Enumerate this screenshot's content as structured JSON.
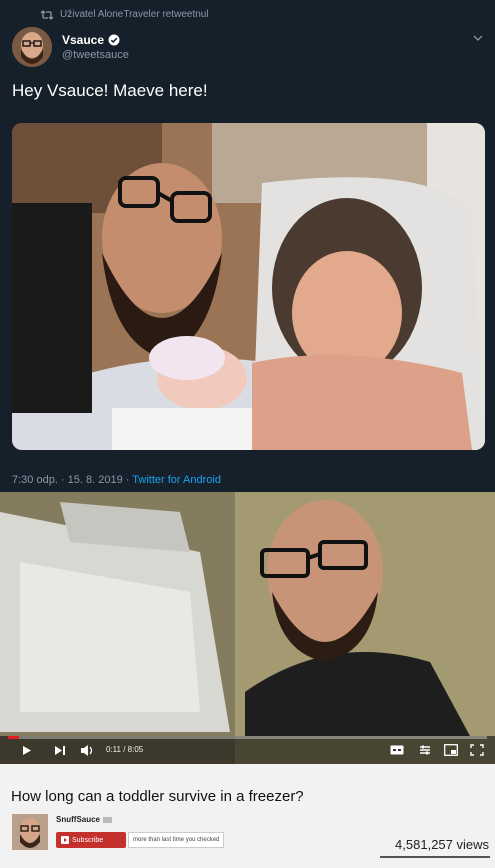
{
  "tweet": {
    "retweet_text": "Uživatel AloneTraveler retweetnul",
    "author_name": "Vsauce",
    "author_handle": "@tweetsauce",
    "text": "Hey Vsauce! Maeve here!",
    "timestamp": "7:30 odp. · 15. 8. 2019 ·",
    "source": "Twitter for Android",
    "link_color": "#1da1f2",
    "icons": [
      "retweet-icon",
      "verified-icon",
      "chevron-down-icon"
    ]
  },
  "video": {
    "time": "0:11 / 8:05",
    "progress_fraction": 0.023,
    "progress_color": "#e31b23",
    "icons": [
      "play-icon",
      "next-icon",
      "volume-icon",
      "captions-icon",
      "settings-icon",
      "miniplayer-icon",
      "fullscreen-icon"
    ]
  },
  "youtube": {
    "title": "How long can a toddler survive in a freezer?",
    "channel_name": "SnuffSauce",
    "subscribe_label": "Subscribe",
    "subscriber_text": "more than last time you checked",
    "views": "4,581,257 views",
    "subscribe_color": "#c4302b"
  }
}
